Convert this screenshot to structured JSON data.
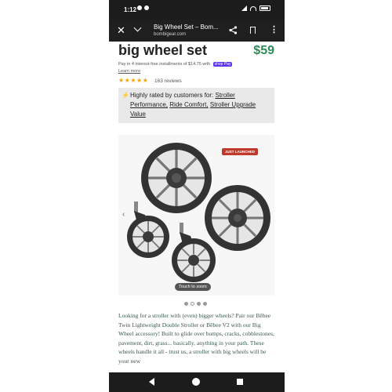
{
  "status_bar": {
    "time": "1:12"
  },
  "browser": {
    "page_title": "Big Wheel Set – Bom...",
    "domain": "bombigear.com"
  },
  "product": {
    "title": "big wheel set",
    "price": "$59",
    "installment_text": "Pay in 4 interest-free installments of $14.75 with",
    "shop_pay_label": "shop Pay",
    "learn_more": "Learn more",
    "rating_stars": "★★★★★",
    "reviews_count": "163 reviews",
    "rated_prefix": "Highly rated by customers for:",
    "rated_tags": [
      "Stroller Performance,",
      "Ride Comfort,",
      "Stroller Upgrade Value"
    ],
    "badge": "JUST LAUNCHED",
    "zoom_hint": "Touch to zoom",
    "description": "Looking for a stroller with (even) bigger wheels? Pair our Bēbee Twin Lightweight Double Stroller or Bēbee V2 with our Big Wheel accessory! Built to glide over bumps, cracks, cobblestones, pavement, dirt, grass... basically, anything in your path. These wheels handle it all - trust us, a stroller with big wheels will be your new"
  },
  "carousel": {
    "count": 4,
    "active_index": 1
  },
  "colors": {
    "price": "#2e8b57",
    "badge": "#c0392b",
    "stars": "#f2a600",
    "shop_pay": "#5a31f4"
  }
}
